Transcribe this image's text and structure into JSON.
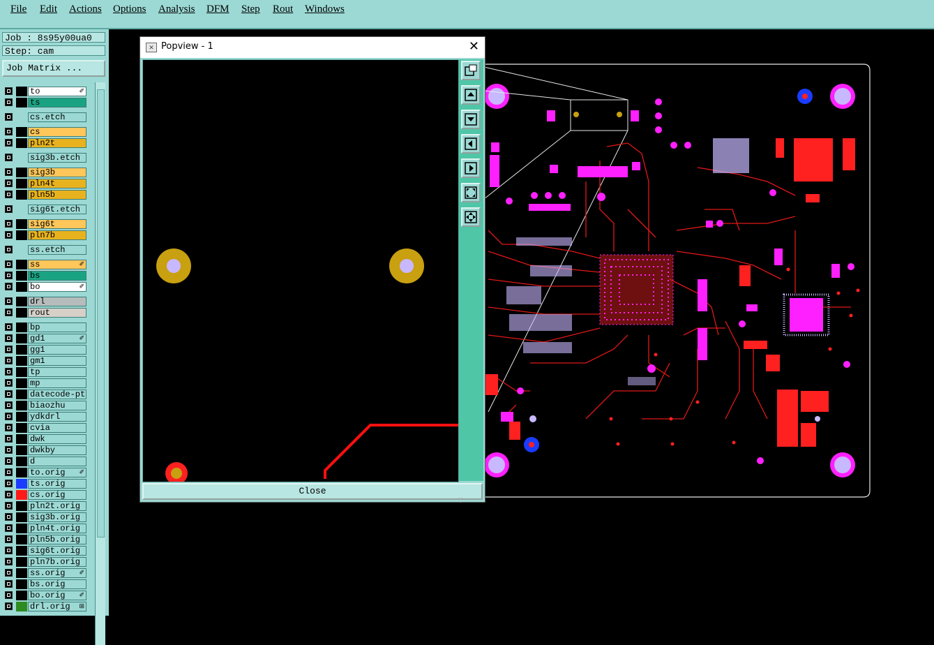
{
  "menu": [
    "File",
    "Edit",
    "Actions",
    "Options",
    "Analysis",
    "DFM",
    "Step",
    "Rout",
    "Windows"
  ],
  "job": {
    "job_label": "Job : 8s95y00ua0",
    "step_label": "Step: cam",
    "matrix_button": "Job Matrix ..."
  },
  "layers": [
    {
      "name": "to",
      "color": "#ffffff",
      "swatch": "#000000",
      "mark": "✐",
      "gap": false
    },
    {
      "name": "ts",
      "color": "#1aa382",
      "swatch": "#000000",
      "mark": "",
      "gap": false
    },
    {
      "name": "cs.etch",
      "color": "#9cd9d4",
      "swatch": "#9cd9d4",
      "mark": "",
      "gap": true
    },
    {
      "name": "cs",
      "color": "#ffc65a",
      "swatch": "#000000",
      "mark": "",
      "gap": true
    },
    {
      "name": "pln2t",
      "color": "#e8b21e",
      "swatch": "#000000",
      "mark": "",
      "gap": false
    },
    {
      "name": "sig3b.etch",
      "color": "#9cd9d4",
      "swatch": "#9cd9d4",
      "mark": "",
      "gap": true
    },
    {
      "name": "sig3b",
      "color": "#ffc65a",
      "swatch": "#000000",
      "mark": "",
      "gap": true
    },
    {
      "name": "pln4t",
      "color": "#e8b21e",
      "swatch": "#000000",
      "mark": "",
      "gap": false
    },
    {
      "name": "pln5b",
      "color": "#e8b21e",
      "swatch": "#000000",
      "mark": "",
      "gap": false
    },
    {
      "name": "sig6t.etch",
      "color": "#9cd9d4",
      "swatch": "#9cd9d4",
      "mark": "",
      "gap": true
    },
    {
      "name": "sig6t",
      "color": "#ffc65a",
      "swatch": "#000000",
      "mark": "",
      "gap": true
    },
    {
      "name": "pln7b",
      "color": "#e8b21e",
      "swatch": "#000000",
      "mark": "",
      "gap": false
    },
    {
      "name": "ss.etch",
      "color": "#9cd9d4",
      "swatch": "#9cd9d4",
      "mark": "",
      "gap": true
    },
    {
      "name": "ss",
      "color": "#ffc65a",
      "swatch": "#000000",
      "mark": "✐",
      "gap": true
    },
    {
      "name": "bs",
      "color": "#1aa382",
      "swatch": "#000000",
      "mark": "",
      "gap": false
    },
    {
      "name": "bo",
      "color": "#ffffff",
      "swatch": "#000000",
      "mark": "✐",
      "gap": false
    },
    {
      "name": "drl",
      "color": "#b6bcbc",
      "swatch": "#000000",
      "mark": "",
      "gap": true
    },
    {
      "name": "rout",
      "color": "#d6d0c8",
      "swatch": "#000000",
      "mark": "",
      "gap": false
    },
    {
      "name": "bp",
      "color": "#9cd9d4",
      "swatch": "#000000",
      "mark": "",
      "gap": true
    },
    {
      "name": "gd1",
      "color": "#9cd9d4",
      "swatch": "#000000",
      "mark": "✐",
      "gap": false
    },
    {
      "name": "gg1",
      "color": "#9cd9d4",
      "swatch": "#000000",
      "mark": "",
      "gap": false
    },
    {
      "name": "gm1",
      "color": "#9cd9d4",
      "swatch": "#000000",
      "mark": "",
      "gap": false
    },
    {
      "name": "tp",
      "color": "#9cd9d4",
      "swatch": "#000000",
      "mark": "",
      "gap": false
    },
    {
      "name": "mp",
      "color": "#9cd9d4",
      "swatch": "#000000",
      "mark": "",
      "gap": false
    },
    {
      "name": "datecode-ptc",
      "color": "#9cd9d4",
      "swatch": "#000000",
      "mark": "",
      "gap": false
    },
    {
      "name": "biaozhu",
      "color": "#9cd9d4",
      "swatch": "#000000",
      "mark": "",
      "gap": false
    },
    {
      "name": "ydkdrl",
      "color": "#9cd9d4",
      "swatch": "#000000",
      "mark": "",
      "gap": false
    },
    {
      "name": "cvia",
      "color": "#9cd9d4",
      "swatch": "#000000",
      "mark": "",
      "gap": false
    },
    {
      "name": "dwk",
      "color": "#9cd9d4",
      "swatch": "#000000",
      "mark": "",
      "gap": false
    },
    {
      "name": "dwkby",
      "color": "#9cd9d4",
      "swatch": "#000000",
      "mark": "",
      "gap": false
    },
    {
      "name": "d",
      "color": "#9cd9d4",
      "swatch": "#000000",
      "mark": "",
      "gap": false
    },
    {
      "name": "to.orig",
      "color": "#9cd9d4",
      "swatch": "#000000",
      "mark": "✐",
      "gap": false
    },
    {
      "name": "ts.orig",
      "color": "#9cd9d4",
      "swatch": "#1a3cff",
      "mark": "",
      "gap": false
    },
    {
      "name": "cs.orig",
      "color": "#9cd9d4",
      "swatch": "#ff1a1a",
      "mark": "",
      "gap": false
    },
    {
      "name": "pln2t.orig",
      "color": "#9cd9d4",
      "swatch": "#000000",
      "mark": "",
      "gap": false
    },
    {
      "name": "sig3b.orig",
      "color": "#9cd9d4",
      "swatch": "#000000",
      "mark": "",
      "gap": false
    },
    {
      "name": "pln4t.orig",
      "color": "#9cd9d4",
      "swatch": "#000000",
      "mark": "",
      "gap": false
    },
    {
      "name": "pln5b.orig",
      "color": "#9cd9d4",
      "swatch": "#000000",
      "mark": "",
      "gap": false
    },
    {
      "name": "sig6t.orig",
      "color": "#9cd9d4",
      "swatch": "#000000",
      "mark": "",
      "gap": false
    },
    {
      "name": "pln7b.orig",
      "color": "#9cd9d4",
      "swatch": "#000000",
      "mark": "",
      "gap": false
    },
    {
      "name": "ss.orig",
      "color": "#9cd9d4",
      "swatch": "#000000",
      "mark": "✐",
      "gap": false
    },
    {
      "name": "bs.orig",
      "color": "#9cd9d4",
      "swatch": "#000000",
      "mark": "",
      "gap": false
    },
    {
      "name": "bo.orig",
      "color": "#9cd9d4",
      "swatch": "#000000",
      "mark": "✐",
      "gap": false
    },
    {
      "name": "drl.orig",
      "color": "#9cd9d4",
      "swatch": "#2e8b1f",
      "mark": "⊞",
      "gap": false
    }
  ],
  "popview": {
    "title": "Popview - 1",
    "close_button": "Close",
    "tools": [
      "zoom-window-icon",
      "zoom-in-icon",
      "zoom-out-icon",
      "pan-left-icon",
      "pan-right-icon",
      "zoom-fit-icon",
      "zoom-home-icon"
    ]
  },
  "colors": {
    "ui_bg": "#9cd9d4",
    "tool_strip": "#4fc6a6",
    "trace": "#e01818",
    "pad": "#ff20ff",
    "gold_pad": "#c8a010"
  }
}
